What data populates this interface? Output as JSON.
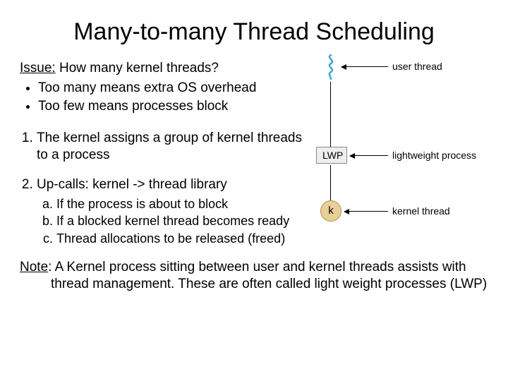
{
  "title": "Many-to-many Thread Scheduling",
  "issue": {
    "label": "Issue:",
    "text": " How many kernel threads?"
  },
  "bullets": [
    "Too many means extra OS overhead",
    "Too few means processes block"
  ],
  "numbered": [
    {
      "text": "The kernel assigns a group of kernel threads to a process"
    },
    {
      "text": "Up-calls: kernel -> thread library",
      "sub": [
        "If the process is about to block",
        "If a blocked kernel thread becomes ready",
        "Thread allocations to be released (freed)"
      ]
    }
  ],
  "note": {
    "label": "Note",
    "text": ": A Kernel process sitting between user and kernel threads assists with thread management. These are often called light weight processes (LWP)"
  },
  "diagram": {
    "user_thread_label": "user thread",
    "lwp_box": "LWP",
    "lwp_label": "lightweight process",
    "k_circle": "k",
    "kernel_thread_label": "kernel thread"
  }
}
